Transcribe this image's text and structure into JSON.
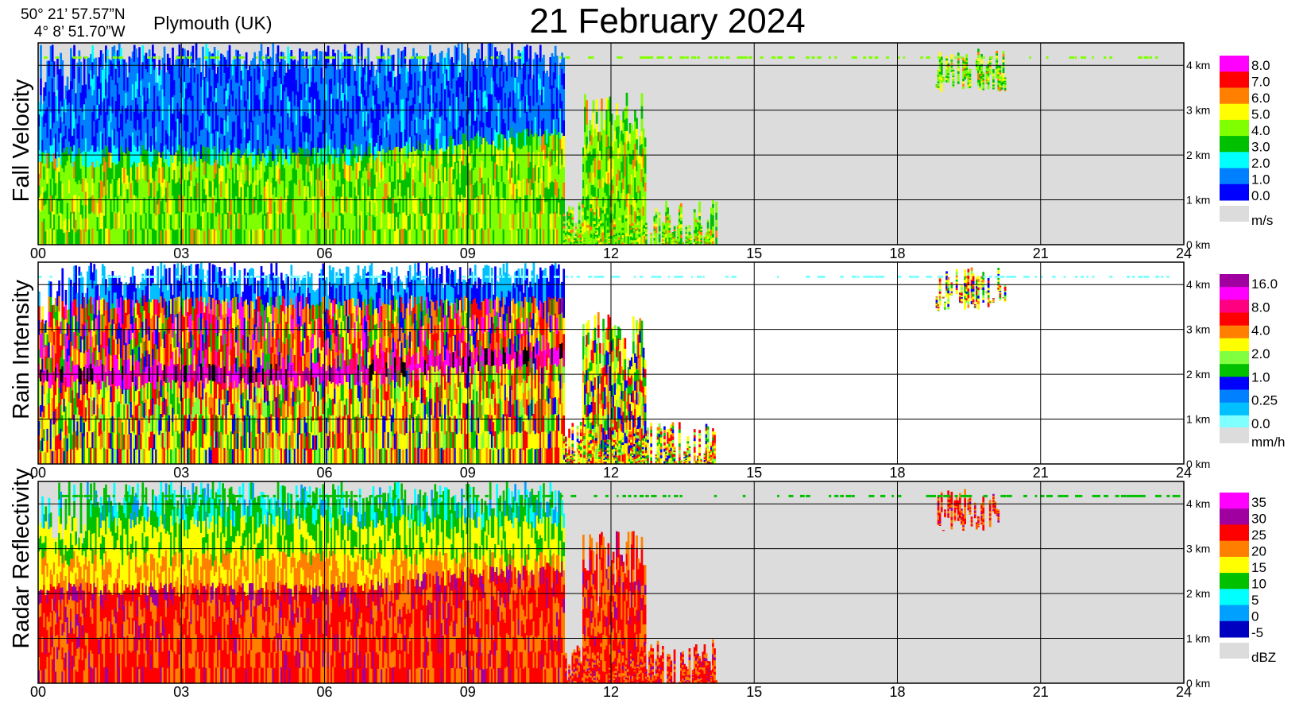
{
  "header": {
    "lat": "50° 21’ 57.57”N",
    "lon": "4°  8’ 51.70”W",
    "station": "Plymouth (UK)",
    "title": "21 February  2024"
  },
  "chart_data": [
    {
      "type": "heatmap",
      "ylabel": "Fall Velocity",
      "x_ticks": [
        "00",
        "03",
        "06",
        "09",
        "12",
        "15",
        "18",
        "21",
        "24"
      ],
      "xlim": [
        0,
        24
      ],
      "y_ticks": [
        "0 km",
        "1 km",
        "2 km",
        "3 km",
        "4 km"
      ],
      "ylim": [
        0,
        4.5
      ],
      "grid": true,
      "nodata_color": "#dcdcdc",
      "colorbar": {
        "unit": "m/s",
        "labels": [
          "8.0",
          "7.0",
          "6.0",
          "5.0",
          "4.0",
          "3.0",
          "2.0",
          "1.0",
          "0.0"
        ],
        "colors": [
          "#ff00ff",
          "#ff0000",
          "#ff8000",
          "#ffff00",
          "#80ff00",
          "#00c000",
          "#00ffff",
          "#0080ff",
          "#0000ff"
        ]
      },
      "field": "fall",
      "echo_regions": [
        {
          "x": [
            0,
            11.0
          ],
          "top": 4.5,
          "melt": 2.0,
          "melt_end": 2.5
        },
        {
          "x": [
            11.4,
            12.7
          ],
          "top": 3.4
        },
        {
          "x": [
            11.0,
            14.2
          ],
          "top": 1.0
        },
        {
          "x": [
            18.8,
            20.3
          ],
          "top": 4.4,
          "bottom": 3.4
        }
      ]
    },
    {
      "type": "heatmap",
      "ylabel": "Rain Intensity",
      "x_ticks": [
        "00",
        "03",
        "06",
        "09",
        "12",
        "15",
        "18",
        "21",
        "24"
      ],
      "xlim": [
        0,
        24
      ],
      "y_ticks": [
        "0 km",
        "1 km",
        "2 km",
        "3 km",
        "4 km"
      ],
      "ylim": [
        0,
        4.5
      ],
      "grid": true,
      "nodata_color": "#ffffff",
      "colorbar": {
        "unit": "mm/h",
        "labels": [
          "16.0",
          "8.0",
          "4.0",
          "2.0",
          "1.0",
          "0.25",
          "0.0"
        ],
        "colors": [
          "#a000a0",
          "#ff00ff",
          "#ff0080",
          "#ff0000",
          "#ff8000",
          "#ffff00",
          "#80ff40",
          "#00c000",
          "#0000ff",
          "#0080ff",
          "#00c0ff",
          "#80ffff"
        ]
      },
      "field": "rain",
      "echo_regions": [
        {
          "x": [
            0,
            11.0
          ],
          "top": 4.5,
          "melt": 2.0,
          "melt_end": 2.5
        },
        {
          "x": [
            11.4,
            12.7
          ],
          "top": 3.4
        },
        {
          "x": [
            11.0,
            14.2
          ],
          "top": 1.0
        },
        {
          "x": [
            18.8,
            20.3
          ],
          "top": 4.4,
          "bottom": 3.4
        }
      ]
    },
    {
      "type": "heatmap",
      "ylabel": "Radar Reflectivity",
      "x_ticks": [
        "00",
        "03",
        "06",
        "09",
        "12",
        "15",
        "18",
        "21",
        "24"
      ],
      "xlim": [
        0,
        24
      ],
      "y_ticks": [
        "0 km",
        "1 km",
        "2 km",
        "3 km",
        "4 km"
      ],
      "ylim": [
        0,
        4.5
      ],
      "grid": true,
      "nodata_color": "#dcdcdc",
      "colorbar": {
        "unit": "dBZ",
        "labels": [
          "35",
          "30",
          "25",
          "20",
          "15",
          "10",
          "5",
          "0",
          "-5"
        ],
        "colors": [
          "#ff00ff",
          "#a000a0",
          "#ff0000",
          "#ff8000",
          "#ffff00",
          "#00c000",
          "#00ffff",
          "#00a0ff",
          "#0000c0"
        ]
      },
      "field": "refl",
      "echo_regions": [
        {
          "x": [
            0,
            11.0
          ],
          "top": 4.5,
          "melt": 2.0,
          "melt_end": 2.5
        },
        {
          "x": [
            11.4,
            12.7
          ],
          "top": 3.4
        },
        {
          "x": [
            11.0,
            14.2
          ],
          "top": 1.0
        },
        {
          "x": [
            18.8,
            20.3
          ],
          "top": 4.4,
          "bottom": 3.4
        }
      ]
    }
  ]
}
